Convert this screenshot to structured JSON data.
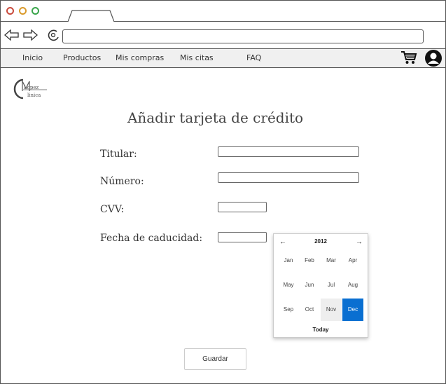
{
  "menu": [
    "Inicio",
    "Productos",
    "Mis compras",
    "Mis citas",
    "FAQ"
  ],
  "logo": {
    "text": "LopezClinica"
  },
  "page_title": "Añadir tarjeta de crédito",
  "form": {
    "titular_label": "Titular:",
    "numero_label": "Número:",
    "cvv_label": "CVV:",
    "fecha_label": "Fecha de caducidad:"
  },
  "datepicker": {
    "year": "2012",
    "prev": "←",
    "next": "→",
    "months": [
      "Jan",
      "Feb",
      "Mar",
      "Apr",
      "May",
      "Jun",
      "Jul",
      "Aug",
      "Sep",
      "Oct",
      "Nov",
      "Dec"
    ],
    "selected_month": "Dec",
    "today_label": "Today"
  },
  "save_button": "Guardar",
  "colors": {
    "accent": "#0a6fd1",
    "menubar": "#f0f0f0"
  }
}
